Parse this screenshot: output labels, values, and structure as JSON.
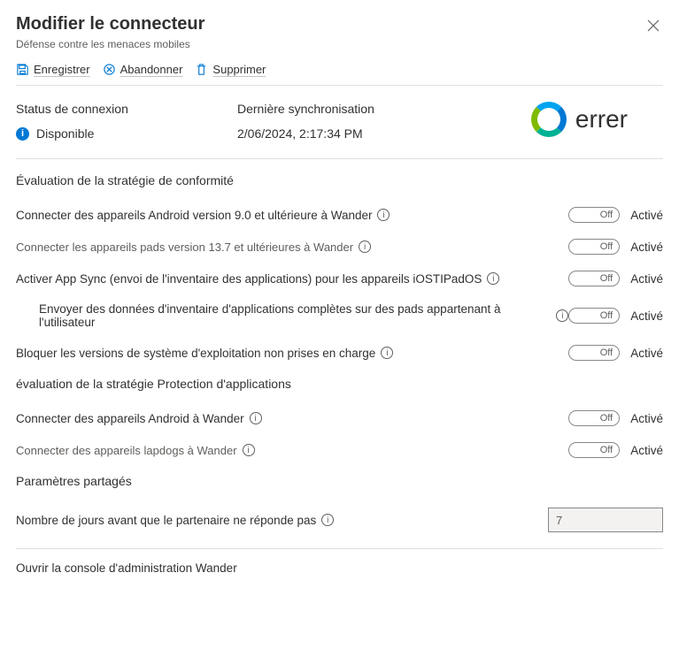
{
  "header": {
    "title": "Modifier le connecteur",
    "subtitle": "Défense contre les menaces mobiles"
  },
  "toolbar": {
    "save": "Enregistrer",
    "discard": "Abandonner",
    "delete": "Supprimer"
  },
  "status": {
    "connection_label": "Status de connexion",
    "connection_value": "Disponible",
    "lastsync_label": "Dernière synchronisation",
    "lastsync_value": "2/06/2024, 2:17:34 PM"
  },
  "brand": {
    "text": "errer"
  },
  "sections": {
    "compliance": "Évaluation de la stratégie de conformité",
    "appprotect": "évaluation de la stratégie Protection d'applications",
    "shared": "Paramètres partagés"
  },
  "settings": {
    "c1": "Connecter des appareils Android version 9.0 et ultérieure à Wander",
    "c2": "Connecter les appareils pads version 13.7 et ultérieures à Wander",
    "c3": "Activer App Sync (envoi de l'inventaire des applications) pour les appareils iOSTIPadOS",
    "c4": "Envoyer des données d'inventaire d'applications complètes sur des pads appartenant à l'utilisateur",
    "c5": "Bloquer les versions de système d'exploitation non prises en charge",
    "a1": "Connecter des appareils Android à Wander",
    "a2": "Connecter des appareils lapdogs à Wander",
    "days_label": "Nombre de jours avant que le partenaire ne réponde pas",
    "days_value": "7"
  },
  "toggle": {
    "off": "Off",
    "on": "Activé"
  },
  "footer": {
    "open_console": "Ouvrir la console d'administration Wander"
  }
}
